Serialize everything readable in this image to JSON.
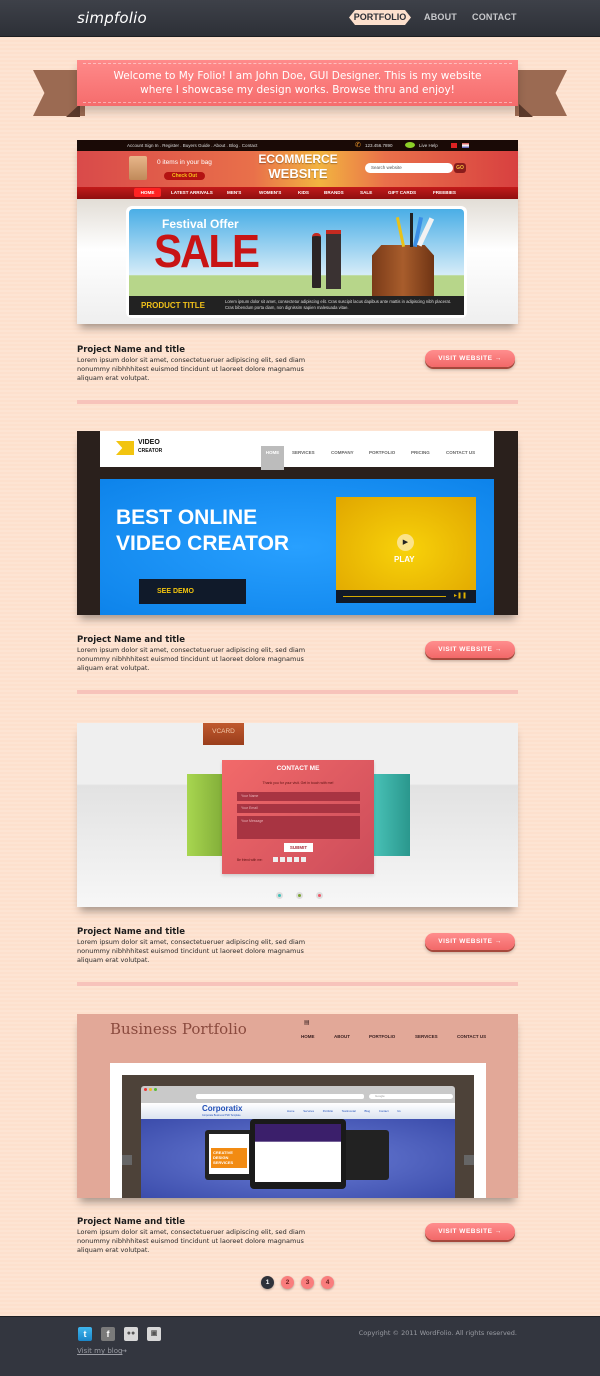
{
  "header": {
    "logo": "simpfolio",
    "nav": [
      {
        "label": "PORTFOLIO",
        "active": true
      },
      {
        "label": "ABOUT",
        "active": false
      },
      {
        "label": "CONTACT",
        "active": false
      }
    ]
  },
  "banner": {
    "line1": "Welcome to My Folio! I am John Doe, GUI Designer. This is my website",
    "line2": "where I showcase my design works. Browse thru and enjoy!"
  },
  "projects": [
    {
      "title": "Project Name and title",
      "description": "Lorem ipsum dolor sit amet, consectetueruer adipiscing elit, sed diam nonummy nibhhhitest euismod tincidunt ut laoreet dolore magnamus aliquam erat volutpat.",
      "button": "VISIT WEBSITE →"
    },
    {
      "title": "Project Name and title",
      "description": "Lorem ipsum dolor sit amet, consectetueruer adipiscing elit, sed diam nonummy nibhhhitest euismod tincidunt ut laoreet dolore magnamus aliquam erat volutpat.",
      "button": "VISIT WEBSITE →"
    },
    {
      "title": "Project Name and title",
      "description": "Lorem ipsum dolor sit amet, consectetueruer adipiscing elit, sed diam nonummy nibhhhitest euismod tincidunt ut laoreet dolore magnamus aliquam erat volutpat.",
      "button": "VISIT WEBSITE →"
    },
    {
      "title": "Project Name and title",
      "description": "Lorem ipsum dolor sit amet, consectetueruer adipiscing elit, sed diam nonummy nibhhhitest euismod tincidunt ut laoreet dolore magnamus aliquam erat volutpat.",
      "button": "VISIT WEBSITE →"
    }
  ],
  "shot_ecommerce": {
    "toplinks": "Account Sign In  .  Register  .  Buyers Guide  .  About  .  Blog  .  Contact",
    "phone": "123.456.7890",
    "live_help": "Live Help",
    "bag": "0 items in your bag",
    "checkout": "Check Out",
    "logo1": "ECOMMERCE",
    "logo2": "WEBSITE",
    "search_placeholder": "Search website",
    "go": "GO",
    "nav": [
      "HOME",
      "LATEST ARRIVALS",
      "MEN'S",
      "WOMEN'S",
      "KIDS",
      "BRANDS",
      "SALE",
      "GIFT CARDS",
      "FREEBIES"
    ],
    "festival": "Festival Offer",
    "sale": "SALE",
    "product_title": "PRODUCT TITLE",
    "product_desc": "Lorem ipsum dolor sit amet, consectetur adipiscing elit. Cras suscipit lacus dapibus ante mattis in adipiscing nibh placerat. Cras bibendum porta diam, non dignissim sapien malesuada vitae."
  },
  "shot_video": {
    "logo1": "VIDEO",
    "logo2": "CREATOR",
    "nav": [
      "HOME",
      "SERVICES",
      "COMPANY",
      "PORTFOLIO",
      "PRICING",
      "CONTACT US"
    ],
    "headline1": "BEST ONLINE",
    "headline2": "VIDEO CREATOR",
    "demo": "SEE DEMO",
    "play": "PLAY"
  },
  "shot_vcard": {
    "tag": "VCARD",
    "title": "CONTACT ME",
    "subtitle": "Thank you for your visit. Get in touch with me!",
    "name_ph": "Your Name",
    "email_ph": "Your Email",
    "message_ph": "Your Message",
    "submit": "SUBMIT",
    "friend": "Be friend with me:"
  },
  "shot_business": {
    "title": "Business Portfolio",
    "nav": [
      "HOME",
      "ABOUT",
      "PORTFOLIO",
      "SERVICES",
      "CONTACT US"
    ],
    "inner_logo": "Corporatix",
    "inner_tagline": "Corporate Business PSD Template",
    "inner_nav": [
      "Home",
      "Services",
      "Portfolio",
      "Testimonial",
      "Blog",
      "Contact Us"
    ],
    "search": "Google",
    "creative": "CREATIVE DESIGN SERVICES"
  },
  "pagination": {
    "pages": [
      "1",
      "2",
      "3",
      "4"
    ],
    "current": "1"
  },
  "footer": {
    "social": [
      "twitter",
      "facebook",
      "flickr",
      "youtube"
    ],
    "blog_link": "Visit my blog",
    "copyright": "Copyright © 2011 WordFolio. All rights reserved."
  }
}
